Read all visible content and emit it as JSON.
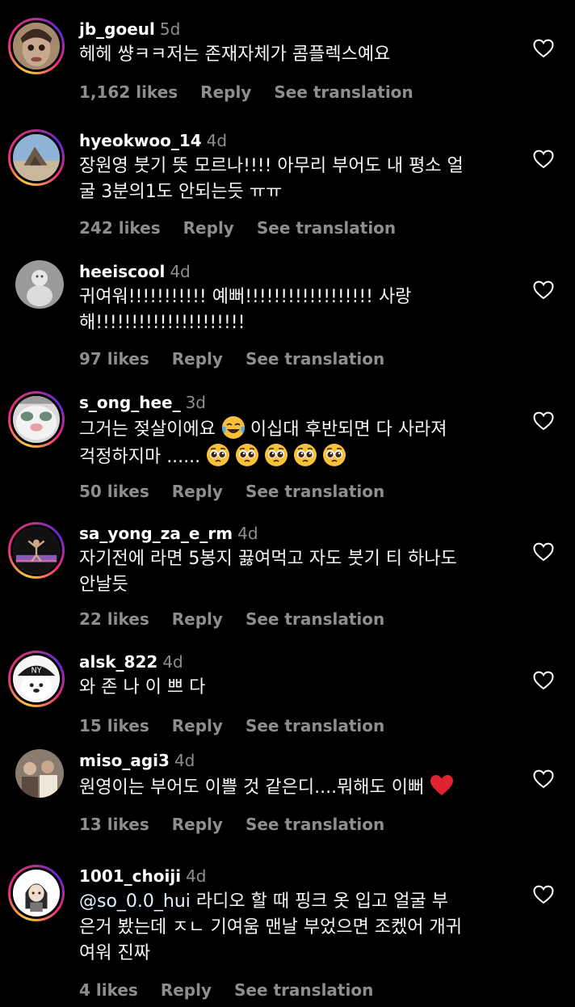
{
  "actions": {
    "reply": "Reply",
    "see_translation": "See translation"
  },
  "comments": [
    {
      "username": "jb_goeul",
      "time": "5d",
      "text": "헤헤 썅ㅋㅋ저는 존재자체가 콤플렉스예요",
      "likes": "1,162 likes",
      "avatar_icon": "doll-face-avatar"
    },
    {
      "username": "hyeokwoo_14",
      "time": "4d",
      "text1": "장원영 붓기 뜻 모르나!!!! 아무리 부어도 내 평소 얼",
      "text2": "굴 3분의1도 안되는듯 ㅠㅠ",
      "likes": "242 likes",
      "avatar_icon": "rock-landscape-avatar"
    },
    {
      "username": "heeiscool",
      "time": "4d",
      "text1": "귀여워!!!!!!!!!!! 예뻐!!!!!!!!!!!!!!!!!! 사랑",
      "text2": "해!!!!!!!!!!!!!!!!!!!!!",
      "likes": "97 likes",
      "avatar_icon": "snowman-avatar"
    },
    {
      "username": "s_ong_hee_",
      "time": "3d",
      "text1a": "그거는 젖살이에요",
      "text1b": "이십대 후반되면 다 사라져",
      "text2": "걱정하지마 ......",
      "likes": "50 likes",
      "avatar_icon": "cat-face-avatar",
      "emoji1": "tears-of-joy-emoji",
      "emoji2": "pleading-face-emoji"
    },
    {
      "username": "sa_yong_za_e_rm",
      "time": "4d",
      "text1": "자기전에 라면 5봉지 끓여먹고 자도 붓기 티 하나도",
      "text2": "안날듯",
      "likes": "22 likes",
      "avatar_icon": "dancer-avatar"
    },
    {
      "username": "alsk_822",
      "time": "4d",
      "text": "와 존 나 이 쁘 다",
      "likes": "15 likes",
      "avatar_icon": "dog-cap-avatar"
    },
    {
      "username": "miso_agi3",
      "time": "4d",
      "text": "원영이는 부어도 이쁠 것 같은디....뭐해도 이뻐",
      "likes": "13 likes",
      "avatar_icon": "group-photo-avatar",
      "emoji": "red-heart-emoji"
    },
    {
      "username": "1001_choiji",
      "time": "4d",
      "mention": "@so_0.0_hui",
      "text1": " 라디오 할 때 핑크 옷 입고 얼굴 부",
      "text2": "은거 봤는데 ㅈㄴ 기여움 맨날 부었으면 조켔어 개귀",
      "text3": "여워 진짜",
      "likes": "4 likes",
      "avatar_icon": "cartoon-girl-avatar"
    }
  ],
  "colors": {
    "background": "#000000",
    "muted": "#8e8e8e",
    "heart_emoji": "#e0242f"
  }
}
